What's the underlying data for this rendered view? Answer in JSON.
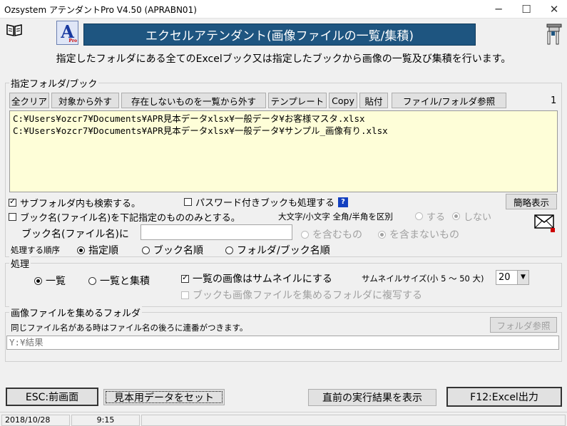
{
  "window": {
    "title": "Ozsystem アテンダントPro V4.50 (APRABN01)"
  },
  "banner": {
    "title": "エクセルアテンダント(画像ファイルの一覧/集積)",
    "logo_letter": "A",
    "logo_sub": "Pro"
  },
  "description": "指定したフォルダにある全てのExcelブック又は指定したブックから画像の一覧及び集積を行います。",
  "folder_group": {
    "label": "指定フォルダ/ブック",
    "buttons": {
      "clear": "全クリア",
      "remove": "対象から外す",
      "remove_missing": "存在しないものを一覧から外す",
      "template": "テンプレート",
      "copy": "Copy",
      "paste": "貼付",
      "browse": "ファイル/フォルダ参照"
    },
    "count": "1",
    "files": [
      "C:¥Users¥ozcr7¥Documents¥APR見本データxlsx¥一般データ¥お客様マスタ.xlsx",
      "C:¥Users¥ozcr7¥Documents¥APR見本データxlsx¥一般データ¥サンプル_画像有り.xlsx"
    ],
    "subfolder_label": "サブフォルダ内も検索する。",
    "subfolder_checked": true,
    "password_label": "パスワード付きブックも処理する",
    "help": "?",
    "simple_view": "簡略表示",
    "bookname_only_label": "ブック名(ファイル名)を下記指定のもののみとする。",
    "case_label": "大文字/小文字 全角/半角を区別",
    "case_yes": "する",
    "case_no": "しない",
    "bookname_label": "ブック名(ファイル名)に",
    "bookname_value": "",
    "contains": "を含むもの",
    "not_contains": "を含まないもの",
    "order_label": "処理する順序",
    "order_options": [
      "指定順",
      "ブック名順",
      "フォルダ/ブック名順"
    ]
  },
  "process_group": {
    "label": "処理",
    "mode_list": "一覧",
    "mode_list_collect": "一覧と集積",
    "thumbnail_label": "一覧の画像はサムネイルにする",
    "thumbnail_checked": true,
    "thumb_size_label": "サムネイルサイズ(小 5 ～ 50 大)",
    "thumb_size": "20",
    "copy_book_label": "ブックも画像ファイルを集めるフォルダに複写する"
  },
  "collect_group": {
    "label": "画像ファイルを集めるフォルダ",
    "note": "同じファイル名がある時はファイル名の後ろに連番がつきます。",
    "browse": "フォルダ参照",
    "path": "Y:¥結果"
  },
  "bottom_buttons": {
    "esc": "ESC:前画面",
    "sample": "見本用データをセット",
    "show_last": "直前の実行結果を表示",
    "f12": "F12:Excel出力"
  },
  "status": {
    "date": "2018/10/28",
    "time": "9:15"
  },
  "icons": {
    "book": "book-icon",
    "help": "help-icon",
    "mail": "mail-icon",
    "pin": "pin-icon"
  },
  "colors": {
    "banner_bg": "#1e5580",
    "textarea_bg": "#fefed8",
    "help_bg": "#1340c0"
  }
}
